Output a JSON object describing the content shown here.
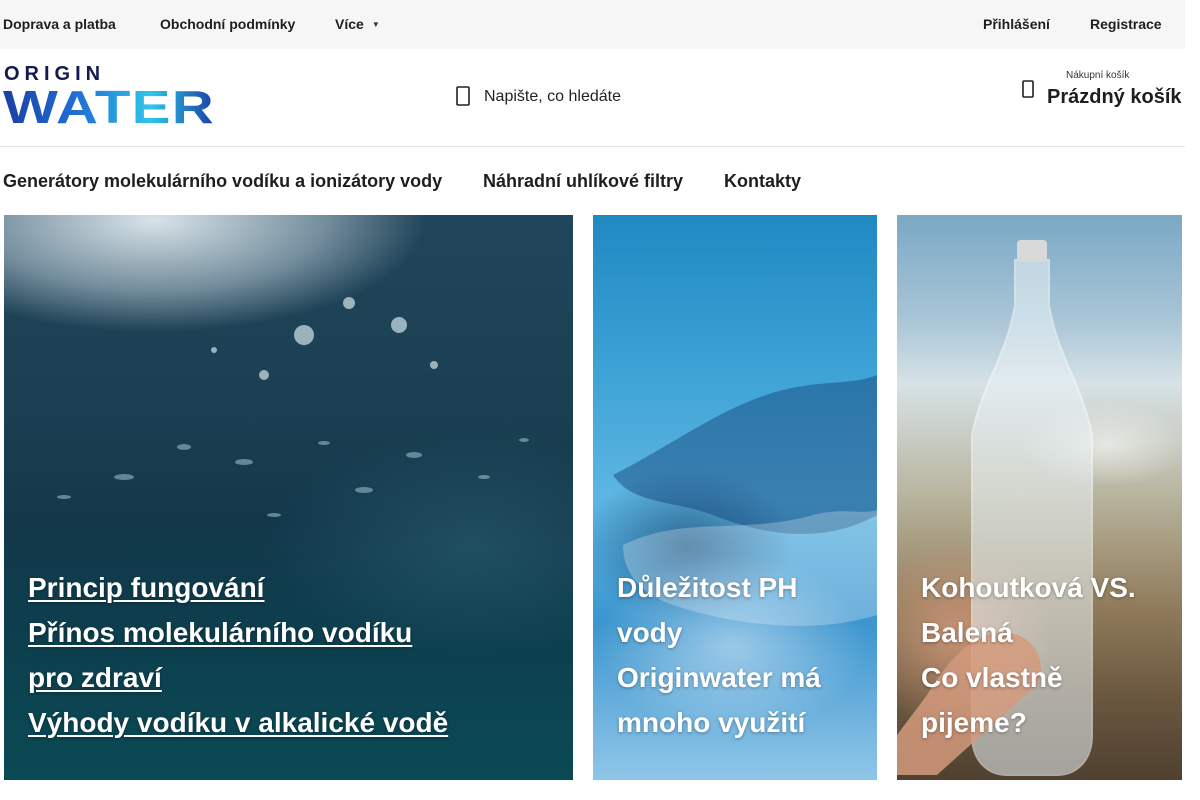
{
  "topbar": {
    "links": [
      "Doprava a platba",
      "Obchodní podmínky",
      "Více"
    ],
    "more_icon": "caret-down-icon",
    "login": "Přihlášení",
    "register": "Registrace"
  },
  "header": {
    "logo": {
      "top_text": "ORIGIN",
      "main_text": "WATER"
    },
    "search": {
      "placeholder": "Napište, co hledáte",
      "icon": "search-icon"
    },
    "cart": {
      "small_label": "Nákupní košík",
      "status": "Prázdný košík",
      "icon": "cart-icon"
    }
  },
  "main_nav": [
    "Generátory molekulárního vodíku a ionizátory vody",
    "Náhradní uhlíkové filtry",
    "Kontakty"
  ],
  "cards": [
    {
      "links": [
        "Princip fungování",
        "Přínos molekulárního vodíku",
        "pro zdraví",
        "Výhody vodíku v alkalické vodě"
      ]
    },
    {
      "lines": [
        "Důležitost PH",
        "vody",
        "Originwater má",
        "mnoho využití"
      ]
    },
    {
      "lines": [
        "Kohoutková VS.",
        "Balená",
        "Co vlastně",
        "pijeme?"
      ]
    }
  ],
  "colors": {
    "logo_navy": "#141a4f",
    "logo_blue": "#1f6fd6",
    "logo_cyan": "#2fc6e8"
  }
}
